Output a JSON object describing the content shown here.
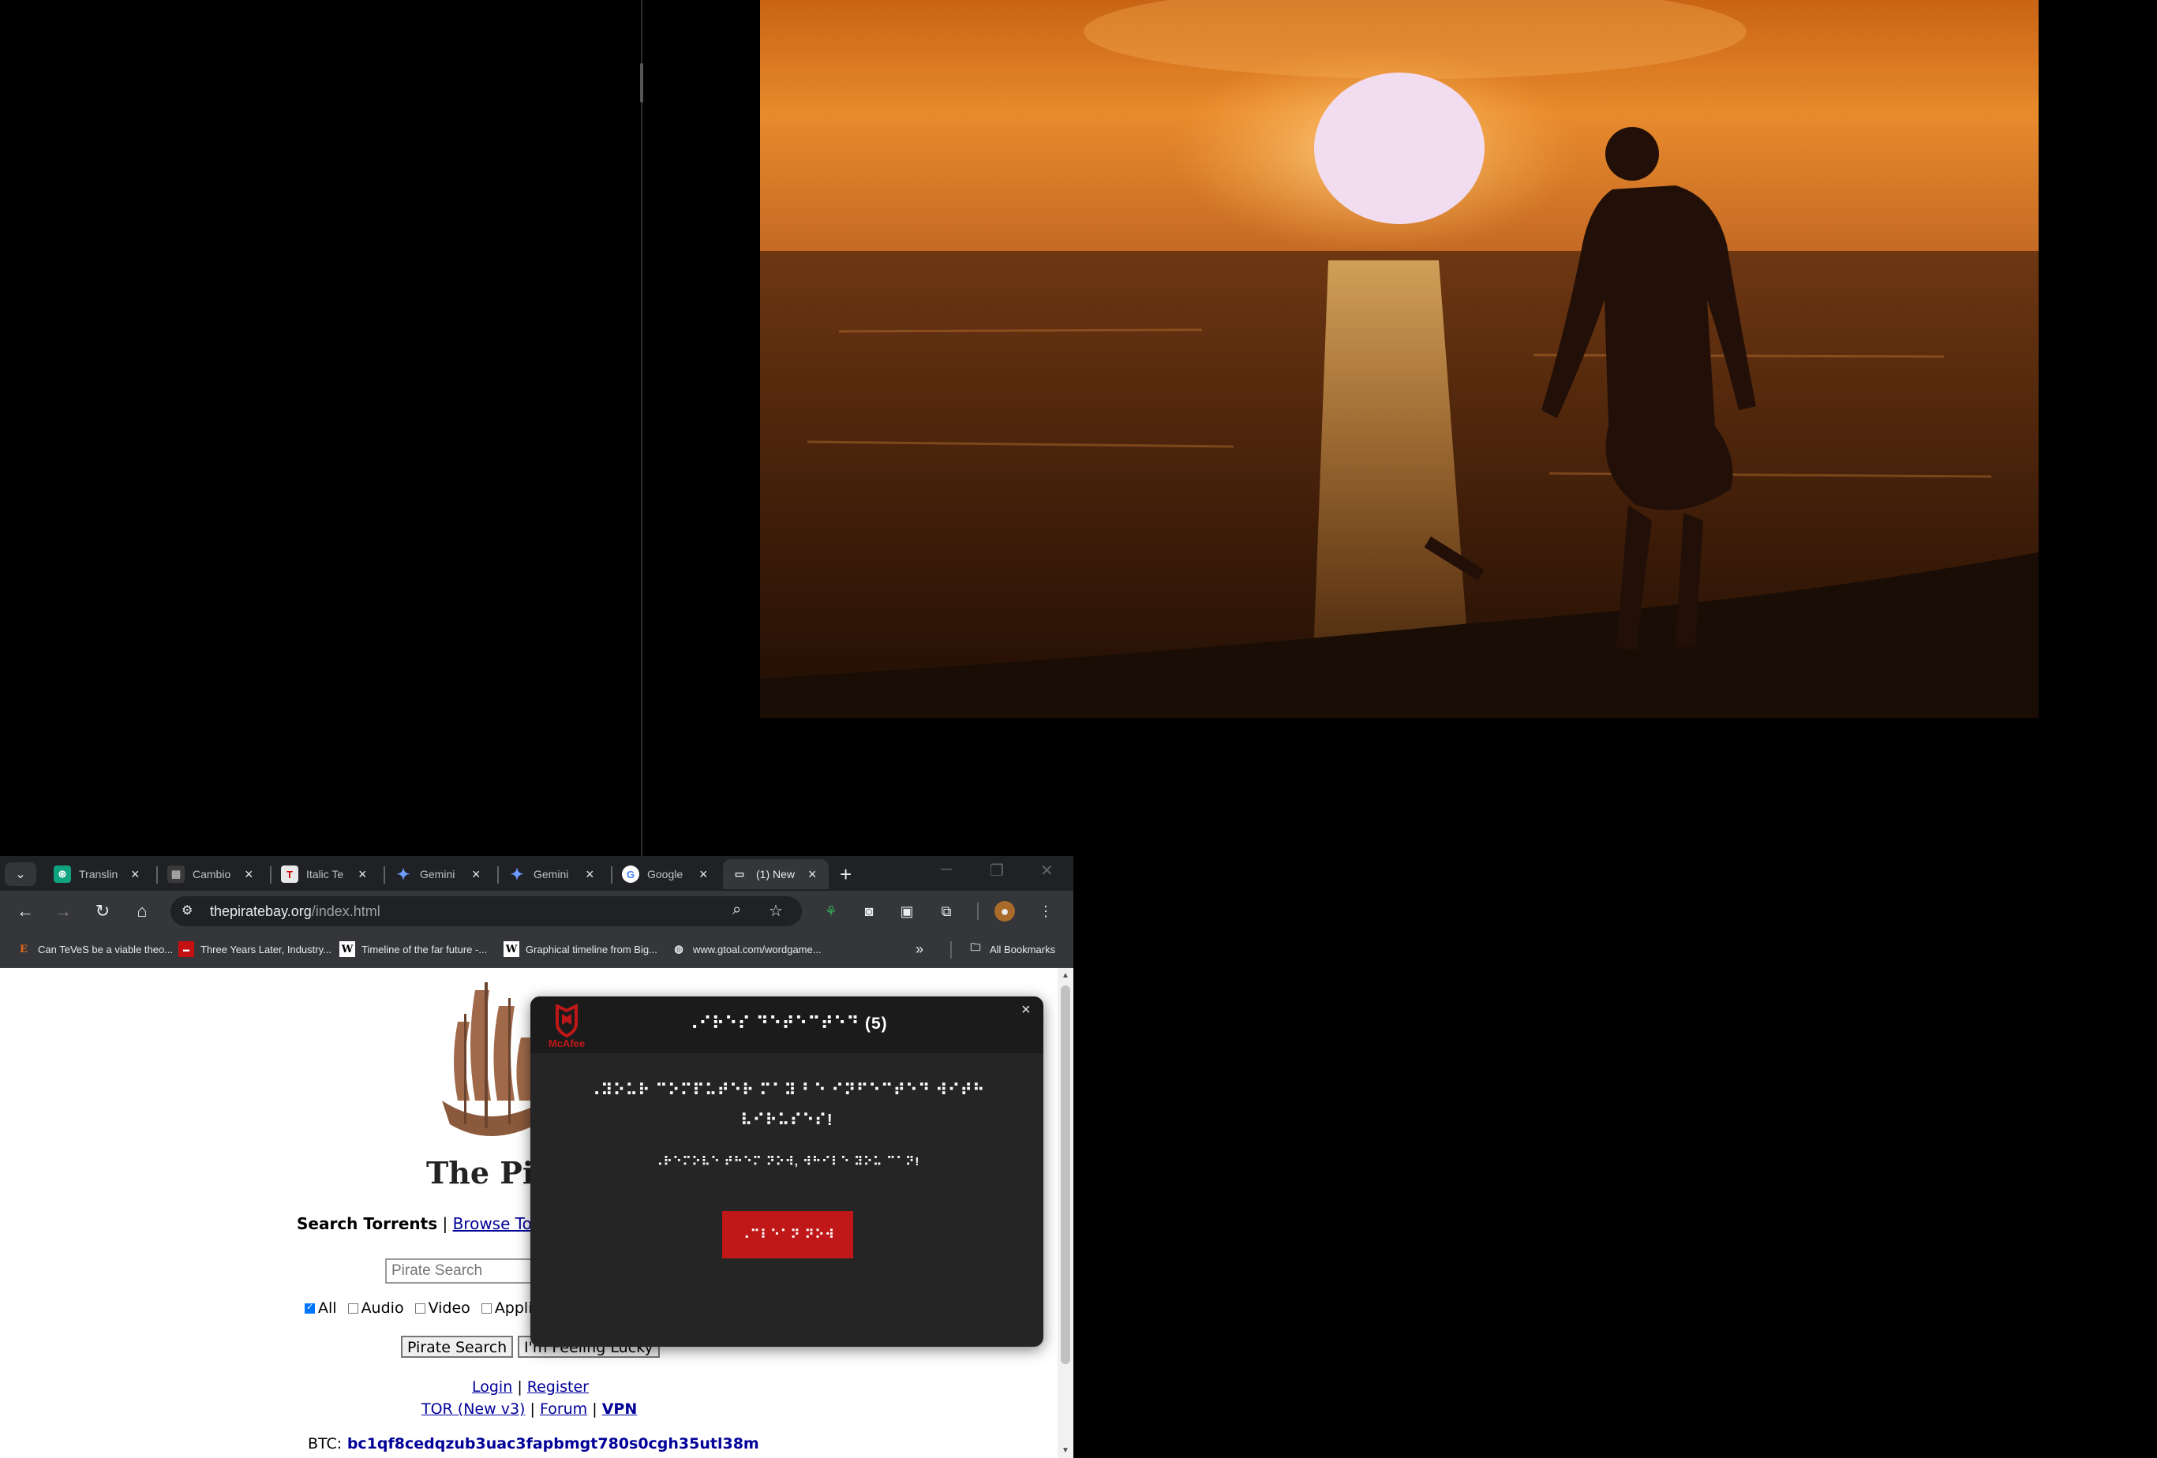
{
  "browser": {
    "tabs": [
      {
        "title": "Translin",
        "favicon": "translate-icon"
      },
      {
        "title": "Cambio",
        "favicon": "cambio-icon"
      },
      {
        "title": "Italic Te",
        "favicon": "italic-text-icon"
      },
      {
        "title": "Gemini",
        "favicon": "gemini-icon"
      },
      {
        "title": "Gemini",
        "favicon": "gemini-icon"
      },
      {
        "title": "Google",
        "favicon": "google-icon"
      },
      {
        "title": "(1) New",
        "favicon": "new-icon",
        "active": true
      }
    ],
    "url_host": "thepiratebay.org",
    "url_path": "/index.html",
    "bookmarks": [
      {
        "label": "Can TeVeS be a viable theo..."
      },
      {
        "label": "Three Years Later, Industry..."
      },
      {
        "label": "Timeline of the far future -..."
      },
      {
        "label": "Graphical timeline from Big..."
      },
      {
        "label": "www.gtoal.com/wordgame..."
      }
    ],
    "all_bookmarks": "All Bookmarks"
  },
  "page": {
    "search_torrents": "Search Torrents",
    "pipe": "|",
    "browse_torrents": "Browse Torre",
    "search_placeholder": "Pirate Search",
    "cat_all": "All",
    "cat_audio": "Audio",
    "cat_video": "Video",
    "cat_applications": "Applica",
    "pirate_search_btn": "Pirate Search",
    "feeling_lucky_btn": "I'm Feeling Lucky",
    "login": "Login",
    "register": "Register",
    "tor": "TOR (New v3)",
    "forum": "Forum",
    "vpn": "VPN",
    "btc_label": "BTC:",
    "btc_value": "bc1qf8cedqzub3uac3fapbmgt780s0cgh35utl38m"
  },
  "popup": {
    "brand": "McAfee",
    "title": "⠠⠊⠗⠑⠎ ⠙⠑⠞⠑⠉⠞⠑⠙ (5)",
    "message": "⠠⠽⠕⠥⠗ ⠉⠕⠍⠏⠥⠞⠑⠗ ⠍⠁⠽ ⠃⠑ ⠊⠝⠋⠑⠉⠞⠑⠙ ⠺⠊⠞⠓ ⠧⠊⠗⠥⠎⠑⠎!",
    "subtext": "⠠⠗⠑⠍⠕⠧⠑ ⠞⠓⠑⠍ ⠝⠕⠺, ⠺⠓⠊⠇⠑ ⠽⠕⠥ ⠉⠁⠝!",
    "button": "⠠⠉⠇⠑⠁⠝ ⠝⠕⠺",
    "close": "×"
  },
  "colors": {
    "chrome_dark": "#202124",
    "toolbar": "#35363a",
    "popup_bg": "#252525",
    "popup_button": "#c01818",
    "link_blue": "#000099"
  }
}
